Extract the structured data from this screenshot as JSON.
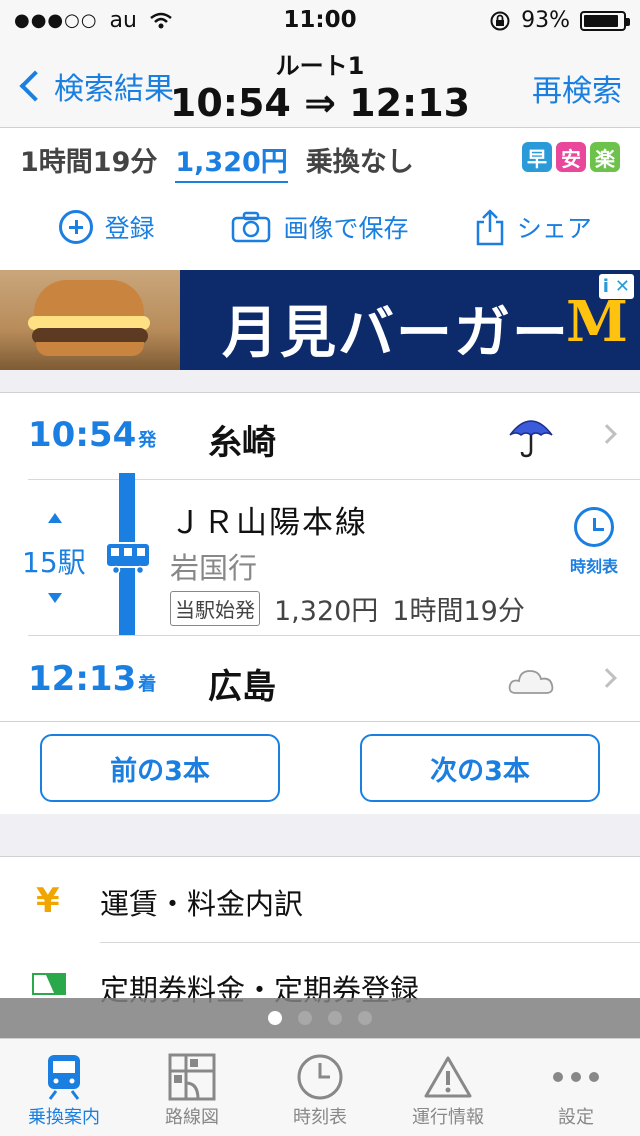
{
  "status": {
    "carrier": "au",
    "time": "11:00",
    "battery": "93%"
  },
  "nav": {
    "back_label": "検索結果",
    "route_title": "ルート1",
    "times": "10:54 ⇒ 12:13",
    "research_label": "再検索"
  },
  "summary": {
    "duration": "1時間19分",
    "fare": "1,320円",
    "transfer": "乗換なし",
    "badges": [
      "早",
      "安",
      "楽"
    ]
  },
  "actions": {
    "register": "登録",
    "save_image": "画像で保存",
    "share": "シェア"
  },
  "ad": {
    "text": "月見バーガー",
    "logo": "M",
    "info": "i",
    "close": "✕"
  },
  "departure": {
    "time": "10:54",
    "suffix": "発",
    "station": "糸崎",
    "weather_icon": "umbrella-icon"
  },
  "segment": {
    "stations": "15駅",
    "line": "ＪＲ山陽本線",
    "destination": "岩国行",
    "origin_tag": "当駅始発",
    "fare": "1,320円",
    "duration": "1時間19分",
    "timetable_label": "時刻表"
  },
  "arrival": {
    "time": "12:13",
    "suffix": "着",
    "station": "広島",
    "weather_icon": "cloud-icon"
  },
  "buttons": {
    "prev": "前の3本",
    "next": "次の3本"
  },
  "list": {
    "fare_breakdown": "運賃・料金内訳",
    "commuter_pass": "定期券料金・定期券登録",
    "yen_symbol": "¥"
  },
  "tabs": [
    {
      "label": "乗換案内",
      "icon": "train-icon",
      "active": true
    },
    {
      "label": "路線図",
      "icon": "route-map-icon",
      "active": false
    },
    {
      "label": "時刻表",
      "icon": "clock-icon",
      "active": false
    },
    {
      "label": "運行情報",
      "icon": "warning-icon",
      "active": false
    },
    {
      "label": "設定",
      "icon": "more-icon",
      "active": false
    }
  ],
  "colors": {
    "accent": "#1a7fe0",
    "badge_fast": "#2a9bd8",
    "badge_cheap": "#e8479b",
    "badge_easy": "#6cc24a"
  }
}
